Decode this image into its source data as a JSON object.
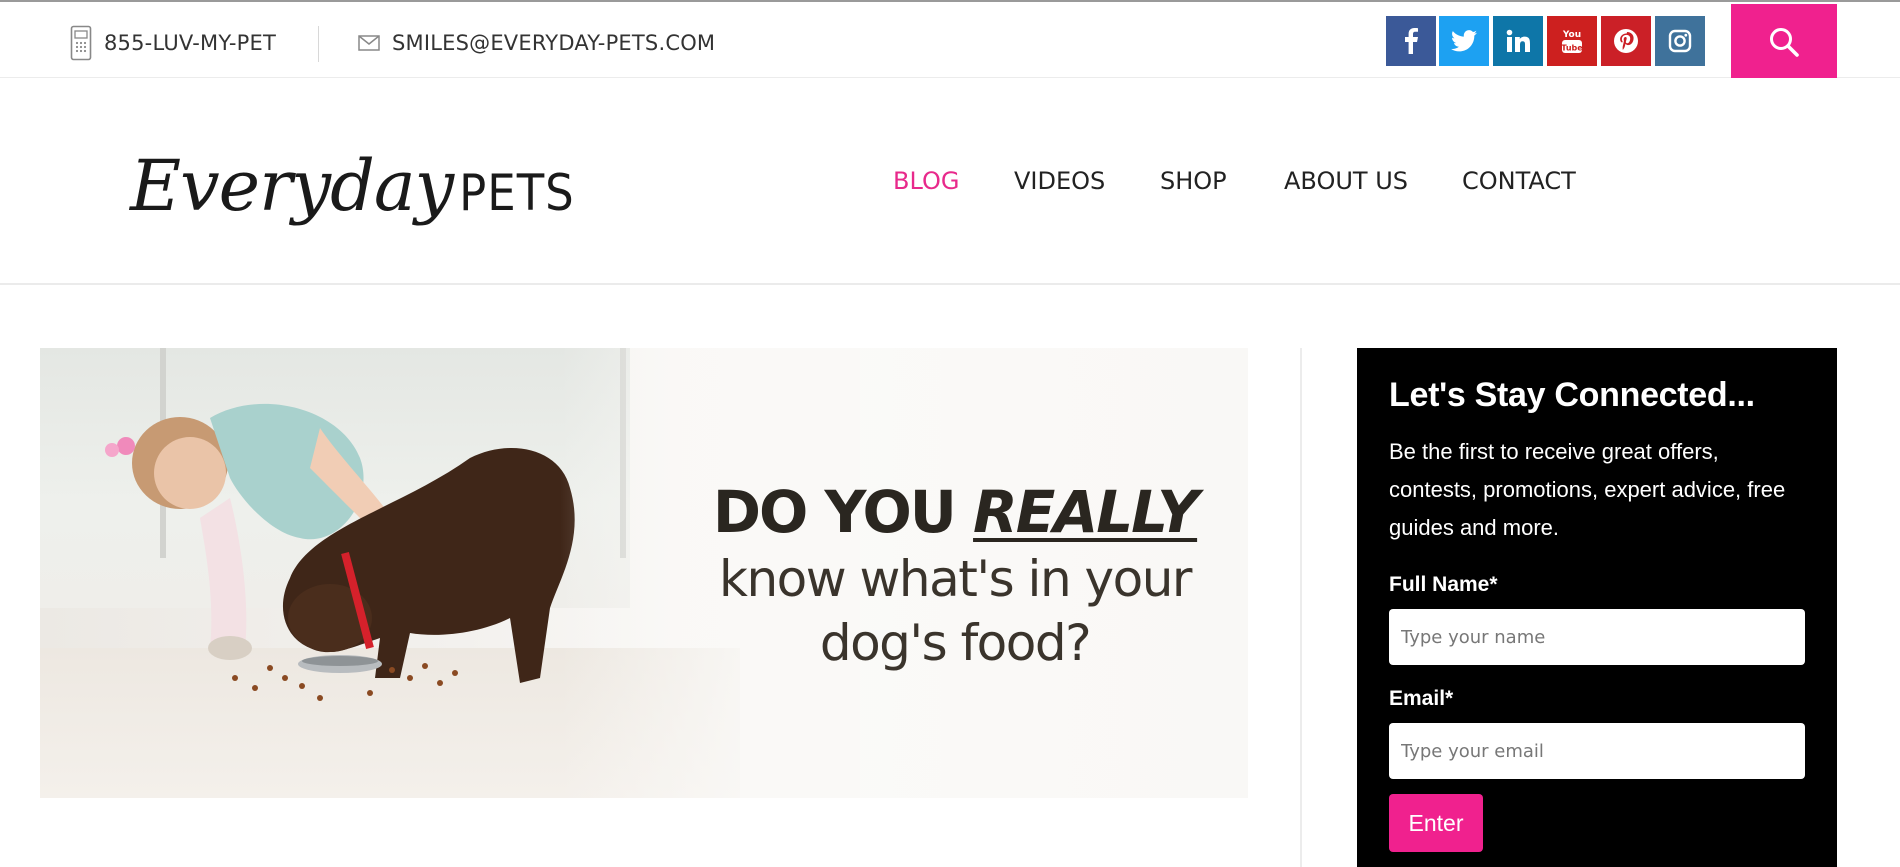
{
  "topbar": {
    "phone": "855-LUV-MY-PET",
    "email": "SMILES@EVERYDAY-PETS.COM",
    "phone_icon": "phone-icon",
    "email_icon": "envelope-icon",
    "social": [
      {
        "name": "facebook",
        "icon": "facebook-icon",
        "glyph": "f",
        "color": "#3b5998"
      },
      {
        "name": "twitter",
        "icon": "twitter-icon",
        "glyph": "t",
        "color": "#1da1f2"
      },
      {
        "name": "linkedin",
        "icon": "linkedin-icon",
        "glyph": "in",
        "color": "#0e76a8"
      },
      {
        "name": "youtube",
        "icon": "youtube-icon",
        "glyph": "You",
        "color": "#cd201f"
      },
      {
        "name": "pinterest",
        "icon": "pinterest-icon",
        "glyph": "p",
        "color": "#cb2027"
      },
      {
        "name": "instagram",
        "icon": "instagram-icon",
        "glyph": "ig",
        "color": "#3f729b"
      }
    ],
    "search_icon": "search-icon",
    "search_color": "#f0218e"
  },
  "header": {
    "logo_word1": "Everyday",
    "logo_word2": "PETS",
    "logo_icon": "paw-icon",
    "logo_icon_color": "#e8298b",
    "nav": [
      {
        "label": "BLOG",
        "active": true
      },
      {
        "label": "VIDEOS",
        "active": false
      },
      {
        "label": "SHOP",
        "active": false
      },
      {
        "label": "ABOUT US",
        "active": false
      },
      {
        "label": "CONTACT",
        "active": false
      }
    ],
    "active_color": "#e8298b"
  },
  "hero": {
    "line1_a": "DO YOU ",
    "line1_b": "REALLY",
    "line2": "know what's in your",
    "line3": "dog's food?"
  },
  "signup": {
    "title": "Let's Stay Connected...",
    "description": "Be the first to receive great offers, contests, promotions, expert advice, free guides and more.",
    "name_label": "Full Name*",
    "name_placeholder": "Type your name",
    "email_label": "Email*",
    "email_placeholder": "Type your email",
    "button_label": "Enter",
    "button_color": "#f0218e"
  }
}
